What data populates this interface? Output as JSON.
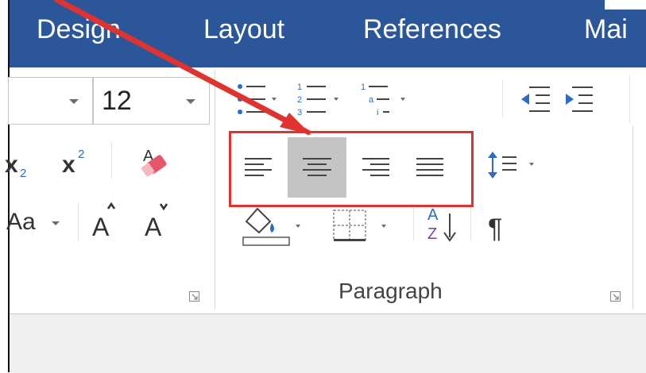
{
  "tabs": [
    {
      "label": "Design"
    },
    {
      "label": "Layout"
    },
    {
      "label": "References"
    },
    {
      "label": "Mai"
    }
  ],
  "font_group": {
    "font_size_value": "12",
    "change_case_label": "Aa"
  },
  "paragraph_group": {
    "group_label": "Paragraph",
    "selected_alignment": "center"
  },
  "colors": {
    "tab_bar": "#2b579a",
    "selected_button": "#c4c4c4",
    "highlight_box": "#e0332f",
    "accent_blue": "#2b6cc4",
    "eraser_pink": "#e8546a"
  }
}
